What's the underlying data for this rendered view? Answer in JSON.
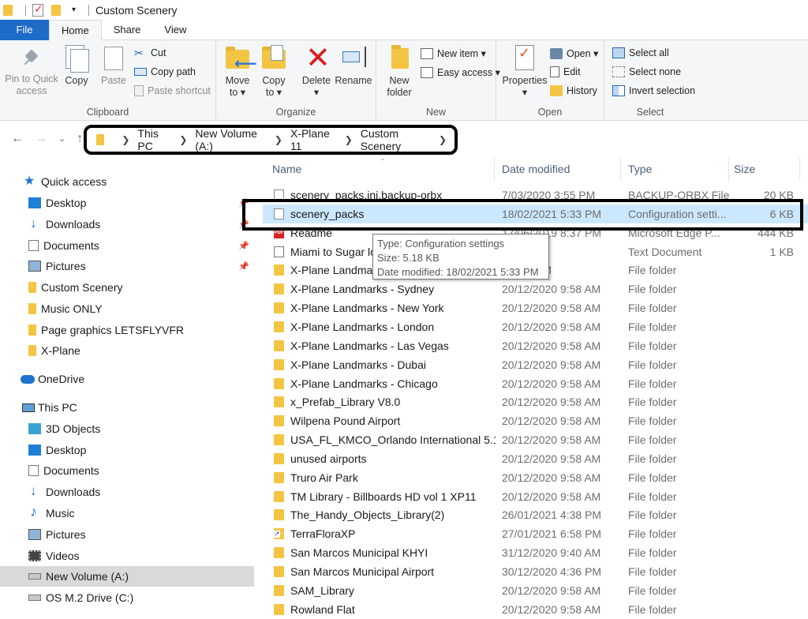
{
  "window": {
    "title": "Custom Scenery"
  },
  "ribbon_tabs": [
    "File",
    "Home",
    "Share",
    "View"
  ],
  "clipboard": {
    "pin_label_1": "Pin to Quick",
    "pin_label_2": "access",
    "copy": "Copy",
    "paste": "Paste",
    "cut": "Cut",
    "copy_path": "Copy path",
    "paste_shortcut": "Paste shortcut",
    "label": "Clipboard"
  },
  "organize": {
    "move_to_1": "Move",
    "move_to_2": "to ▾",
    "copy_to_1": "Copy",
    "copy_to_2": "to ▾",
    "delete_1": "Delete",
    "delete_2": "▾",
    "rename": "Rename",
    "label": "Organize"
  },
  "new": {
    "new_folder_1": "New",
    "new_folder_2": "folder",
    "new_item": "New item ▾",
    "easy_access": "Easy access ▾",
    "label": "New"
  },
  "open": {
    "properties": "Properties",
    "properties_arrow": "▾",
    "open": "Open ▾",
    "edit": "Edit",
    "history": "History",
    "label": "Open"
  },
  "select": {
    "select_all": "Select all",
    "select_none": "Select none",
    "invert_selection": "Invert selection",
    "label": "Select"
  },
  "breadcrumb": [
    "This PC",
    "New Volume (A:)",
    "X-Plane 11",
    "Custom Scenery"
  ],
  "nav_pane": [
    {
      "label": "Quick access",
      "icon": "star-icon"
    },
    {
      "label": "Desktop",
      "icon": "desktop-icon",
      "pinned": true
    },
    {
      "label": "Downloads",
      "icon": "downloads-icon",
      "pinned": true
    },
    {
      "label": "Documents",
      "icon": "documents-icon",
      "pinned": true
    },
    {
      "label": "Pictures",
      "icon": "pictures-icon",
      "pinned": true
    },
    {
      "label": "Custom Scenery",
      "icon": "folder-icon"
    },
    {
      "label": "Music ONLY",
      "icon": "folder-icon"
    },
    {
      "label": "Page graphics LETSFLYVFR",
      "icon": "folder-icon"
    },
    {
      "label": "X-Plane",
      "icon": "folder-icon"
    },
    {
      "label": "OneDrive",
      "icon": "onedrive-icon"
    },
    {
      "label": "This PC",
      "icon": "this-pc-icon"
    },
    {
      "label": "3D Objects",
      "icon": "3d-objects-icon"
    },
    {
      "label": "Desktop",
      "icon": "desktop-icon"
    },
    {
      "label": "Documents",
      "icon": "documents-icon"
    },
    {
      "label": "Downloads",
      "icon": "downloads-icon"
    },
    {
      "label": "Music",
      "icon": "music-icon"
    },
    {
      "label": "Pictures",
      "icon": "pictures-icon"
    },
    {
      "label": "Videos",
      "icon": "videos-icon"
    },
    {
      "label": "New Volume (A:)",
      "icon": "drive-icon",
      "selected": true
    },
    {
      "label": "OS M.2 Drive (C:)",
      "icon": "drive-icon"
    }
  ],
  "columns": {
    "name": "Name",
    "date": "Date modified",
    "type": "Type",
    "size": "Size"
  },
  "files": [
    {
      "name": "scenery_packs.ini.backup-orbx",
      "date": "7/03/2020 3:55 PM",
      "type": "BACKUP-ORBX File",
      "size": "20 KB",
      "kind": "file"
    },
    {
      "name": "scenery_packs",
      "date": "18/02/2021 5:33 PM",
      "type": "Configuration setti...",
      "size": "6 KB",
      "kind": "file",
      "selected": true
    },
    {
      "name": "Readme",
      "date": "17/06/2019 8:37 PM",
      "type": "Microsoft Edge P...",
      "size": "444 KB",
      "kind": "pdf"
    },
    {
      "name": "Miami to Sugar lo",
      "date": "10:27 AM",
      "type": "Text Document",
      "size": "1 KB",
      "kind": "txt"
    },
    {
      "name": "X-Plane Landmark",
      "date": "0 9:58 AM",
      "type": "File folder",
      "size": "",
      "kind": "folder"
    },
    {
      "name": "X-Plane Landmarks - Sydney",
      "date": "20/12/2020 9:58 AM",
      "type": "File folder",
      "size": "",
      "kind": "folder"
    },
    {
      "name": "X-Plane Landmarks - New York",
      "date": "20/12/2020 9:58 AM",
      "type": "File folder",
      "size": "",
      "kind": "folder"
    },
    {
      "name": "X-Plane Landmarks - London",
      "date": "20/12/2020 9:58 AM",
      "type": "File folder",
      "size": "",
      "kind": "folder"
    },
    {
      "name": "X-Plane Landmarks - Las Vegas",
      "date": "20/12/2020 9:58 AM",
      "type": "File folder",
      "size": "",
      "kind": "folder"
    },
    {
      "name": "X-Plane Landmarks - Dubai",
      "date": "20/12/2020 9:58 AM",
      "type": "File folder",
      "size": "",
      "kind": "folder"
    },
    {
      "name": "X-Plane Landmarks - Chicago",
      "date": "20/12/2020 9:58 AM",
      "type": "File folder",
      "size": "",
      "kind": "folder"
    },
    {
      "name": "x_Prefab_Library V8.0",
      "date": "20/12/2020 9:58 AM",
      "type": "File folder",
      "size": "",
      "kind": "folder"
    },
    {
      "name": "Wilpena Pound Airport",
      "date": "20/12/2020 9:58 AM",
      "type": "File folder",
      "size": "",
      "kind": "folder"
    },
    {
      "name": "USA_FL_KMCO_Orlando International 5.1",
      "date": "20/12/2020 9:58 AM",
      "type": "File folder",
      "size": "",
      "kind": "folder"
    },
    {
      "name": "unused airports",
      "date": "20/12/2020 9:58 AM",
      "type": "File folder",
      "size": "",
      "kind": "folder"
    },
    {
      "name": "Truro Air Park",
      "date": "20/12/2020 9:58 AM",
      "type": "File folder",
      "size": "",
      "kind": "folder"
    },
    {
      "name": "TM Library - Billboards HD vol 1 XP11",
      "date": "20/12/2020 9:58 AM",
      "type": "File folder",
      "size": "",
      "kind": "folder"
    },
    {
      "name": "The_Handy_Objects_Library(2)",
      "date": "26/01/2021 4:38 PM",
      "type": "File folder",
      "size": "",
      "kind": "folder"
    },
    {
      "name": "TerraFloraXP",
      "date": "27/01/2021 6:58 PM",
      "type": "File folder",
      "size": "",
      "kind": "shortcut"
    },
    {
      "name": "San Marcos Municipal KHYI",
      "date": "31/12/2020 9:40 AM",
      "type": "File folder",
      "size": "",
      "kind": "folder"
    },
    {
      "name": "San Marcos Municipal Airport",
      "date": "30/12/2020 4:36 PM",
      "type": "File folder",
      "size": "",
      "kind": "folder"
    },
    {
      "name": "SAM_Library",
      "date": "20/12/2020 9:58 AM",
      "type": "File folder",
      "size": "",
      "kind": "folder"
    },
    {
      "name": "Rowland Flat",
      "date": "20/12/2020 9:58 AM",
      "type": "File folder",
      "size": "",
      "kind": "folder"
    }
  ],
  "tooltip": {
    "type": "Type: Configuration settings",
    "size": "Size: 5.18 KB",
    "modified": "Date modified: 18/02/2021 5:33 PM"
  }
}
